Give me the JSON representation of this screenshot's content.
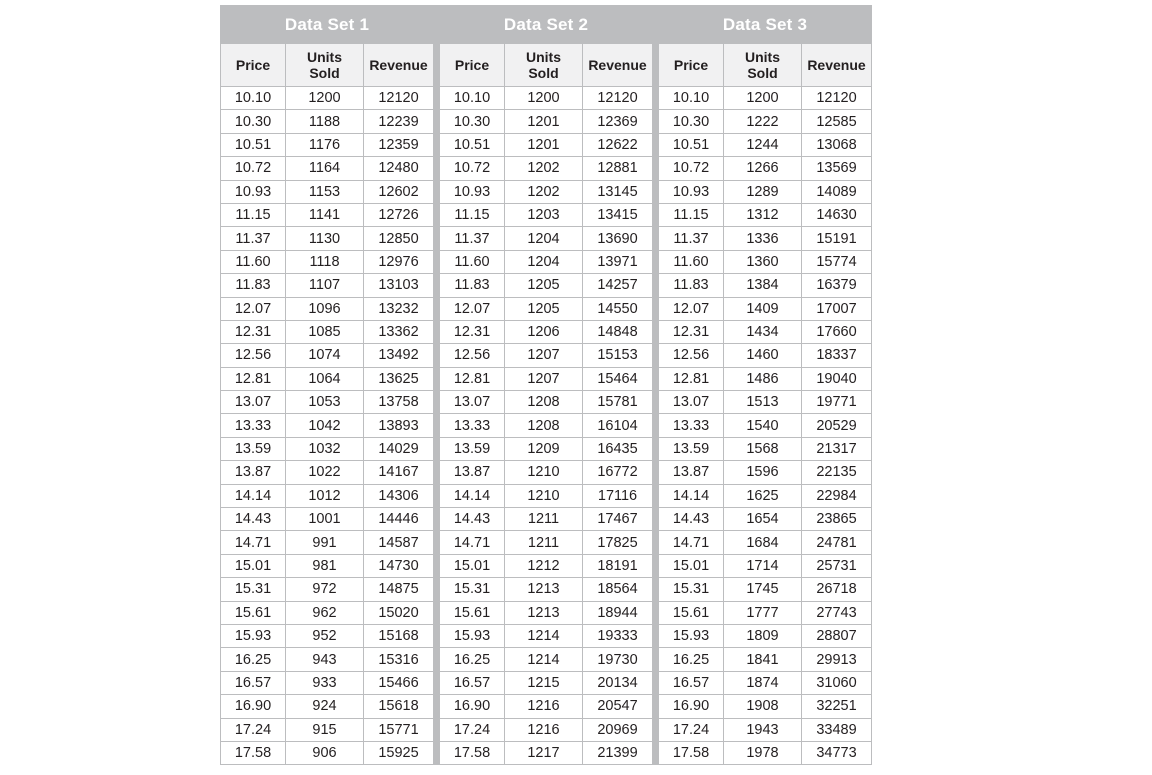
{
  "columns": [
    "Price",
    "Units Sold",
    "Revenue"
  ],
  "column_lines": [
    [
      "Price"
    ],
    [
      "Units",
      "Sold"
    ],
    [
      "Revenue"
    ]
  ],
  "data_sets": [
    {
      "title": "Data Set 1",
      "rows": [
        [
          "10.10",
          "1200",
          "12120"
        ],
        [
          "10.30",
          "1188",
          "12239"
        ],
        [
          "10.51",
          "1176",
          "12359"
        ],
        [
          "10.72",
          "1164",
          "12480"
        ],
        [
          "10.93",
          "1153",
          "12602"
        ],
        [
          "11.15",
          "1141",
          "12726"
        ],
        [
          "11.37",
          "1130",
          "12850"
        ],
        [
          "11.60",
          "1118",
          "12976"
        ],
        [
          "11.83",
          "1107",
          "13103"
        ],
        [
          "12.07",
          "1096",
          "13232"
        ],
        [
          "12.31",
          "1085",
          "13362"
        ],
        [
          "12.56",
          "1074",
          "13492"
        ],
        [
          "12.81",
          "1064",
          "13625"
        ],
        [
          "13.07",
          "1053",
          "13758"
        ],
        [
          "13.33",
          "1042",
          "13893"
        ],
        [
          "13.59",
          "1032",
          "14029"
        ],
        [
          "13.87",
          "1022",
          "14167"
        ],
        [
          "14.14",
          "1012",
          "14306"
        ],
        [
          "14.43",
          "1001",
          "14446"
        ],
        [
          "14.71",
          "991",
          "14587"
        ],
        [
          "15.01",
          "981",
          "14730"
        ],
        [
          "15.31",
          "972",
          "14875"
        ],
        [
          "15.61",
          "962",
          "15020"
        ],
        [
          "15.93",
          "952",
          "15168"
        ],
        [
          "16.25",
          "943",
          "15316"
        ],
        [
          "16.57",
          "933",
          "15466"
        ],
        [
          "16.90",
          "924",
          "15618"
        ],
        [
          "17.24",
          "915",
          "15771"
        ],
        [
          "17.58",
          "906",
          "15925"
        ]
      ]
    },
    {
      "title": "Data Set 2",
      "rows": [
        [
          "10.10",
          "1200",
          "12120"
        ],
        [
          "10.30",
          "1201",
          "12369"
        ],
        [
          "10.51",
          "1201",
          "12622"
        ],
        [
          "10.72",
          "1202",
          "12881"
        ],
        [
          "10.93",
          "1202",
          "13145"
        ],
        [
          "11.15",
          "1203",
          "13415"
        ],
        [
          "11.37",
          "1204",
          "13690"
        ],
        [
          "11.60",
          "1204",
          "13971"
        ],
        [
          "11.83",
          "1205",
          "14257"
        ],
        [
          "12.07",
          "1205",
          "14550"
        ],
        [
          "12.31",
          "1206",
          "14848"
        ],
        [
          "12.56",
          "1207",
          "15153"
        ],
        [
          "12.81",
          "1207",
          "15464"
        ],
        [
          "13.07",
          "1208",
          "15781"
        ],
        [
          "13.33",
          "1208",
          "16104"
        ],
        [
          "13.59",
          "1209",
          "16435"
        ],
        [
          "13.87",
          "1210",
          "16772"
        ],
        [
          "14.14",
          "1210",
          "17116"
        ],
        [
          "14.43",
          "1211",
          "17467"
        ],
        [
          "14.71",
          "1211",
          "17825"
        ],
        [
          "15.01",
          "1212",
          "18191"
        ],
        [
          "15.31",
          "1213",
          "18564"
        ],
        [
          "15.61",
          "1213",
          "18944"
        ],
        [
          "15.93",
          "1214",
          "19333"
        ],
        [
          "16.25",
          "1214",
          "19730"
        ],
        [
          "16.57",
          "1215",
          "20134"
        ],
        [
          "16.90",
          "1216",
          "20547"
        ],
        [
          "17.24",
          "1216",
          "20969"
        ],
        [
          "17.58",
          "1217",
          "21399"
        ]
      ]
    },
    {
      "title": "Data Set 3",
      "rows": [
        [
          "10.10",
          "1200",
          "12120"
        ],
        [
          "10.30",
          "1222",
          "12585"
        ],
        [
          "10.51",
          "1244",
          "13068"
        ],
        [
          "10.72",
          "1266",
          "13569"
        ],
        [
          "10.93",
          "1289",
          "14089"
        ],
        [
          "11.15",
          "1312",
          "14630"
        ],
        [
          "11.37",
          "1336",
          "15191"
        ],
        [
          "11.60",
          "1360",
          "15774"
        ],
        [
          "11.83",
          "1384",
          "16379"
        ],
        [
          "12.07",
          "1409",
          "17007"
        ],
        [
          "12.31",
          "1434",
          "17660"
        ],
        [
          "12.56",
          "1460",
          "18337"
        ],
        [
          "12.81",
          "1486",
          "19040"
        ],
        [
          "13.07",
          "1513",
          "19771"
        ],
        [
          "13.33",
          "1540",
          "20529"
        ],
        [
          "13.59",
          "1568",
          "21317"
        ],
        [
          "13.87",
          "1596",
          "22135"
        ],
        [
          "14.14",
          "1625",
          "22984"
        ],
        [
          "14.43",
          "1654",
          "23865"
        ],
        [
          "14.71",
          "1684",
          "24781"
        ],
        [
          "15.01",
          "1714",
          "25731"
        ],
        [
          "15.31",
          "1745",
          "26718"
        ],
        [
          "15.61",
          "1777",
          "27743"
        ],
        [
          "15.93",
          "1809",
          "28807"
        ],
        [
          "16.25",
          "1841",
          "29913"
        ],
        [
          "16.57",
          "1874",
          "31060"
        ],
        [
          "16.90",
          "1908",
          "32251"
        ],
        [
          "17.24",
          "1943",
          "33489"
        ],
        [
          "17.58",
          "1978",
          "34773"
        ]
      ]
    }
  ],
  "colors": {
    "header_bg": "#bcbdbf",
    "subheader_bg": "#f1f1f2",
    "grid": "#bcbdbf",
    "title_text": "#ffffff"
  }
}
